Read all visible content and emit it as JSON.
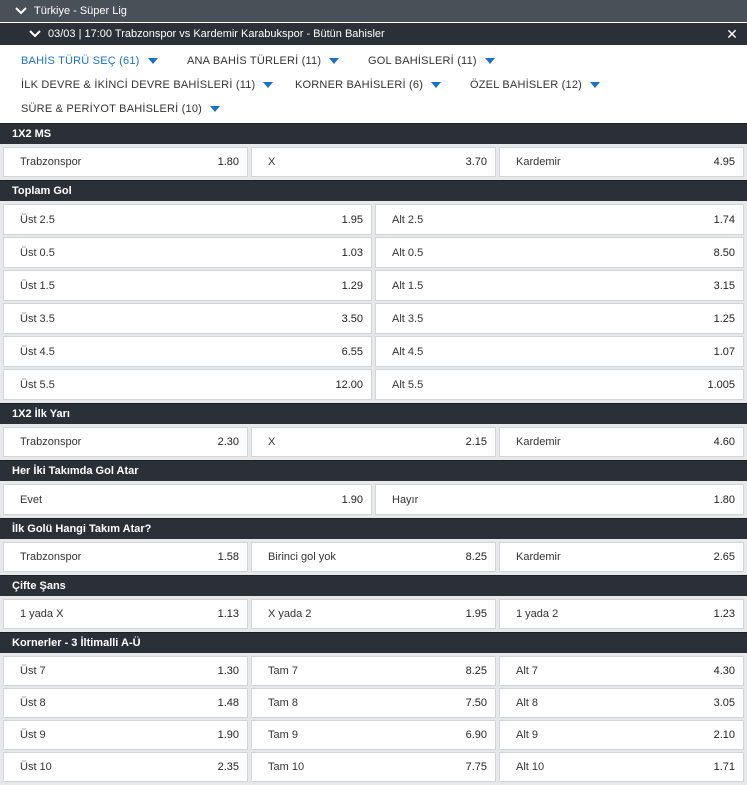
{
  "league": {
    "title": "Türkiye - Süper Lig"
  },
  "match": {
    "title": "03/03 | 17:00 Trabzonspor vs Kardemir Karabukspor - Bütün Bahisler"
  },
  "filters": [
    [
      {
        "label": "BAHİS TÜRÜ SEÇ (61)",
        "active": true
      },
      {
        "label": "ANA BAHİS TÜRLERİ (11)"
      },
      {
        "label": "GOL BAHİSLERİ (11)"
      }
    ],
    [
      {
        "label": "İLK DEVRE & İKİNCİ DEVRE BAHİSLERİ (11)"
      },
      {
        "label": "KORNER BAHİSLERİ (6)"
      },
      {
        "label": "ÖZEL BAHİSLER (12)"
      }
    ],
    [
      {
        "label": "SÜRE & PERİYOT BAHİSLERİ (10)"
      }
    ]
  ],
  "markets": [
    {
      "title": "1X2 MS",
      "rows": [
        [
          {
            "label": "Trabzonspor",
            "odd": "1.80"
          },
          {
            "label": "X",
            "odd": "3.70"
          },
          {
            "label": "Kardemir",
            "odd": "4.95"
          }
        ]
      ]
    },
    {
      "title": "Toplam Gol",
      "rows": [
        [
          {
            "label": "Üst 2.5",
            "odd": "1.95"
          },
          {
            "label": "Alt 2.5",
            "odd": "1.74"
          }
        ],
        [
          {
            "label": "Üst 0.5",
            "odd": "1.03"
          },
          {
            "label": "Alt 0.5",
            "odd": "8.50"
          }
        ],
        [
          {
            "label": "Üst 1.5",
            "odd": "1.29"
          },
          {
            "label": "Alt 1.5",
            "odd": "3.15"
          }
        ],
        [
          {
            "label": "Üst 3.5",
            "odd": "3.50"
          },
          {
            "label": "Alt 3.5",
            "odd": "1.25"
          }
        ],
        [
          {
            "label": "Üst 4.5",
            "odd": "6.55"
          },
          {
            "label": "Alt 4.5",
            "odd": "1.07"
          }
        ],
        [
          {
            "label": "Üst 5.5",
            "odd": "12.00"
          },
          {
            "label": "Alt 5.5",
            "odd": "1.005"
          }
        ]
      ]
    },
    {
      "title": "1X2 İlk Yarı",
      "rows": [
        [
          {
            "label": "Trabzonspor",
            "odd": "2.30"
          },
          {
            "label": "X",
            "odd": "2.15"
          },
          {
            "label": "Kardemir",
            "odd": "4.60"
          }
        ]
      ]
    },
    {
      "title": "Her İki Takımda Gol Atar",
      "rows": [
        [
          {
            "label": "Evet",
            "odd": "1.90"
          },
          {
            "label": "Hayır",
            "odd": "1.80"
          }
        ]
      ]
    },
    {
      "title": "İlk Golü Hangi Takım Atar?",
      "rows": [
        [
          {
            "label": "Trabzonspor",
            "odd": "1.58"
          },
          {
            "label": "Birinci gol yok",
            "odd": "8.25"
          },
          {
            "label": "Kardemir",
            "odd": "2.65"
          }
        ]
      ]
    },
    {
      "title": "Çifte Şans",
      "rows": [
        [
          {
            "label": "1 yada X",
            "odd": "1.13"
          },
          {
            "label": "X yada 2",
            "odd": "1.95"
          },
          {
            "label": "1 yada 2",
            "odd": "1.23"
          }
        ]
      ]
    },
    {
      "title": "Kornerler - 3 İltimalli A-Ü",
      "rows": [
        [
          {
            "label": "Üst 7",
            "odd": "1.30"
          },
          {
            "label": "Tam 7",
            "odd": "8.25"
          },
          {
            "label": "Alt 7",
            "odd": "4.30"
          }
        ],
        [
          {
            "label": "Üst 8",
            "odd": "1.48"
          },
          {
            "label": "Tam 8",
            "odd": "7.50"
          },
          {
            "label": "Alt 8",
            "odd": "3.05"
          }
        ],
        [
          {
            "label": "Üst 9",
            "odd": "1.90"
          },
          {
            "label": "Tam 9",
            "odd": "6.90"
          },
          {
            "label": "Alt 9",
            "odd": "2.10"
          }
        ],
        [
          {
            "label": "Üst 10",
            "odd": "2.35"
          },
          {
            "label": "Tam 10",
            "odd": "7.75"
          },
          {
            "label": "Alt 10",
            "odd": "1.71"
          }
        ]
      ]
    }
  ]
}
